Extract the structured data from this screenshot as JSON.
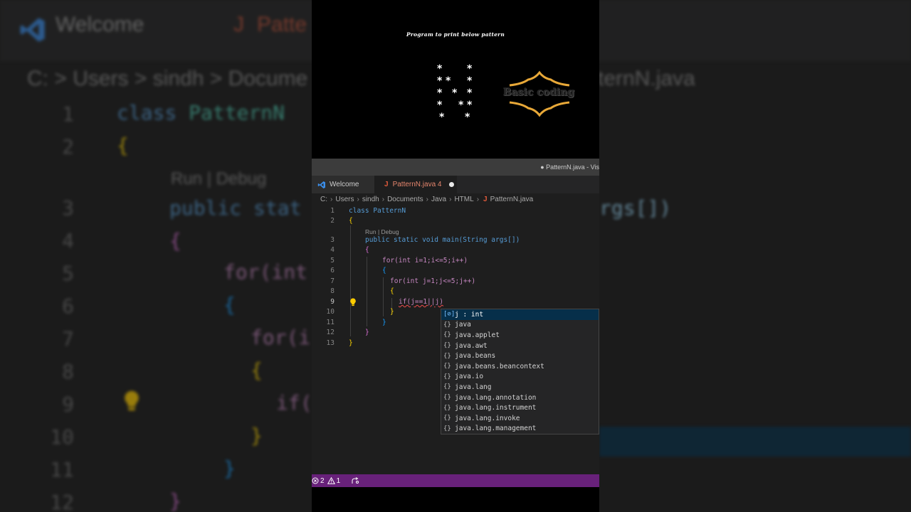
{
  "header": {
    "title": "Program to print below pattern"
  },
  "badge": {
    "text": "Basic coding",
    "color": "#e8a838"
  },
  "pattern": {
    "symbol": "*"
  },
  "window": {
    "title": "● PatternN.java - Vis"
  },
  "tabs": [
    {
      "label": "Welcome"
    },
    {
      "label": "PatternN.java 4"
    }
  ],
  "tab_icon_letter": "J",
  "breadcrumb": [
    "C:",
    "Users",
    "sindh",
    "Documents",
    "Java",
    "HTML",
    "PatternN.java"
  ],
  "codelens": "Run | Debug",
  "code_lines": [
    {
      "num": "1",
      "text": "class PatternN"
    },
    {
      "num": "2",
      "text": "{"
    },
    {
      "num": "3",
      "text": "public static void main(String args[])"
    },
    {
      "num": "4",
      "text": "{"
    },
    {
      "num": "5",
      "text": "for(int i=1;i<=5;i++)"
    },
    {
      "num": "6",
      "text": "{"
    },
    {
      "num": "7",
      "text": "for(int j=1;j<=5;j++)"
    },
    {
      "num": "8",
      "text": "{"
    },
    {
      "num": "9",
      "text": "if(j==1||j)"
    },
    {
      "num": "10",
      "text": "}"
    },
    {
      "num": "11",
      "text": "}"
    },
    {
      "num": "12",
      "text": "}"
    },
    {
      "num": "13",
      "text": "}"
    }
  ],
  "suggestions": [
    {
      "label": "j : int",
      "icon": "[⊘]"
    },
    {
      "label": "java",
      "icon": "{}"
    },
    {
      "label": "java.applet",
      "icon": "{}"
    },
    {
      "label": "java.awt",
      "icon": "{}"
    },
    {
      "label": "java.beans",
      "icon": "{}"
    },
    {
      "label": "java.beans.beancontext",
      "icon": "{}"
    },
    {
      "label": "java.io",
      "icon": "{}"
    },
    {
      "label": "java.lang",
      "icon": "{}"
    },
    {
      "label": "java.lang.annotation",
      "icon": "{}"
    },
    {
      "label": "java.lang.instrument",
      "icon": "{}"
    },
    {
      "label": "java.lang.invoke",
      "icon": "{}"
    },
    {
      "label": "java.lang.management",
      "icon": "{}"
    }
  ],
  "status": {
    "errors": "2",
    "warnings": "1"
  },
  "colors": {
    "statusbar": "#68217a",
    "selection": "#062f4a"
  }
}
